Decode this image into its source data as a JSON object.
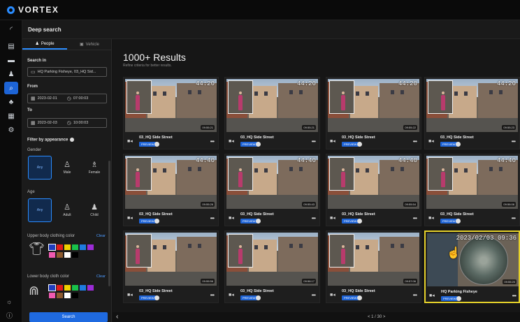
{
  "app": {
    "brand": "VORTEX"
  },
  "header": {
    "title": "Deep search"
  },
  "sidebar": {
    "tabs": [
      {
        "label": "People",
        "active": true,
        "icon": "person-icon"
      },
      {
        "label": "Vehicle",
        "active": false,
        "icon": "vehicle-icon"
      }
    ],
    "search_in": {
      "label": "Search in",
      "value": "HQ Parking Fisheye, 03_HQ Sid..."
    },
    "from": {
      "label": "From",
      "date": "2023-02-01",
      "time": "07:00:03"
    },
    "to": {
      "label": "To",
      "date": "2023-02-03",
      "time": "10:00:03"
    },
    "filter_label": "Filter by appearance",
    "gender": {
      "label": "Gender",
      "options": [
        "Any",
        "Male",
        "Female"
      ],
      "selected": "Any"
    },
    "age": {
      "label": "Age",
      "options": [
        "Any",
        "Adult",
        "Child"
      ],
      "selected": "Any"
    },
    "upper_color": {
      "label": "Upper body clothing color",
      "clear": "Clear",
      "colors": [
        "#1f3dbf",
        "#e01b1b",
        "#f0d000",
        "#19c24a",
        "#1e7be0",
        "#9c2bd6",
        "#f05ab0",
        "#8c5a2e",
        "#ffffff",
        "#000000"
      ]
    },
    "lower_color": {
      "label": "Lower body cloth color",
      "clear": "Clear",
      "colors": [
        "#1f3dbf",
        "#e01b1b",
        "#f0d000",
        "#19c24a",
        "#1e7be0",
        "#9c2bd6",
        "#f05ab0",
        "#8c5a2e",
        "#ffffff",
        "#000000"
      ]
    },
    "search_button": "Search"
  },
  "results": {
    "title": "1000+ Results",
    "subtitle": "Refine criteria for better results.",
    "tag_label": "PREVIEW",
    "cards": [
      {
        "camera": "03_HQ Side Street",
        "timestamp": "44:20",
        "duration": "09:55:21"
      },
      {
        "camera": "03_HQ Side Street",
        "timestamp": "44:20",
        "duration": "09:55:21"
      },
      {
        "camera": "03_HQ Side Street",
        "timestamp": "44:20",
        "duration": "09:55:22"
      },
      {
        "camera": "03_HQ Side Street",
        "timestamp": "44:20",
        "duration": "09:55:23"
      },
      {
        "camera": "03_HQ Side Street",
        "timestamp": "44:40",
        "duration": "09:55:26"
      },
      {
        "camera": "03_HQ Side Street",
        "timestamp": "44:40",
        "duration": "09:55:43"
      },
      {
        "camera": "03_HQ Side Street",
        "timestamp": "44:40",
        "duration": "09:55:54"
      },
      {
        "camera": "03_HQ Side Street",
        "timestamp": "44:40",
        "duration": "09:56:06"
      },
      {
        "camera": "03_HQ Side Street",
        "timestamp": "",
        "duration": "09:55:56"
      },
      {
        "camera": "03_HQ Side Street",
        "timestamp": "",
        "duration": "09:56:17"
      },
      {
        "camera": "03_HQ Side Street",
        "timestamp": "",
        "duration": "09:57:06"
      },
      {
        "camera": "HQ Parking Fisheye",
        "timestamp": "2023/02/03 09:36",
        "duration": "09:55:20"
      }
    ]
  },
  "pager": {
    "page_text": "< 1 / 30 >"
  }
}
